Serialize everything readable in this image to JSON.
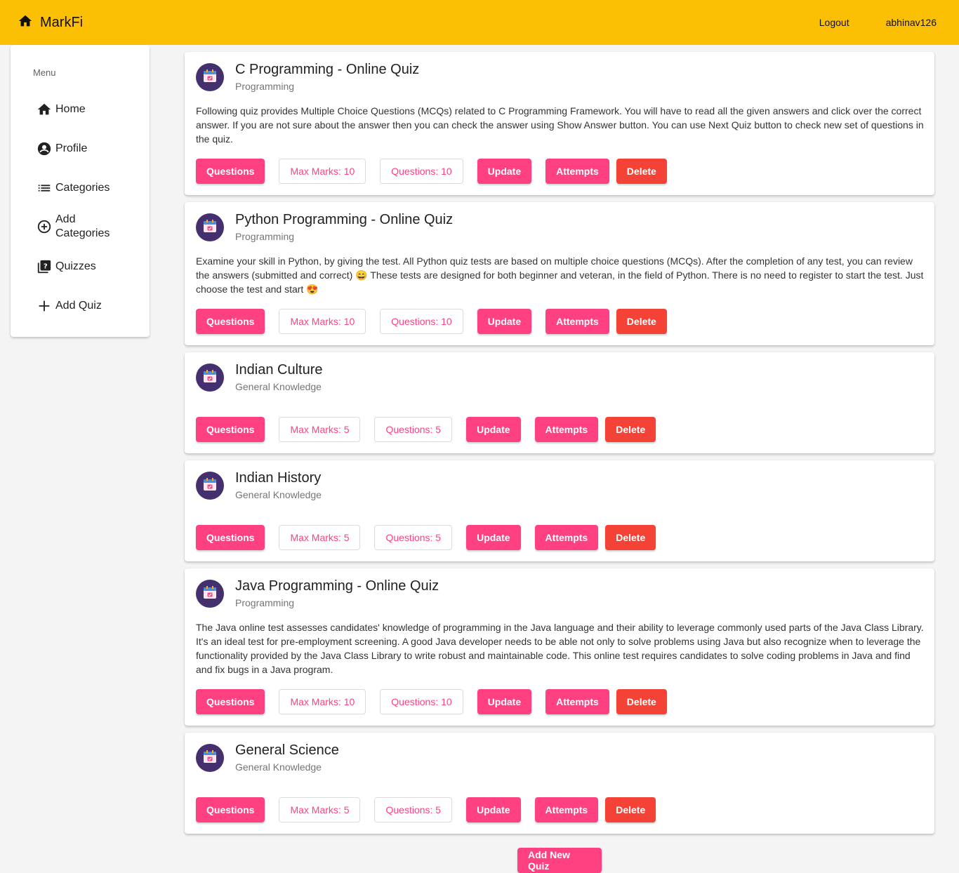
{
  "header": {
    "brand": "MarkFi",
    "logout_label": "Logout",
    "username": "abhinav126"
  },
  "sidebar": {
    "title": "Menu",
    "items": [
      {
        "label": "Home",
        "icon": "home-icon"
      },
      {
        "label": "Profile",
        "icon": "account-circle-icon"
      },
      {
        "label": "Categories",
        "icon": "list-icon"
      },
      {
        "label": "Add Categories",
        "icon": "add-circle-icon"
      },
      {
        "label": "Quizzes",
        "icon": "quiz-icon"
      },
      {
        "label": "Add Quiz",
        "icon": "plus-icon"
      }
    ]
  },
  "buttons": {
    "questions": "Questions",
    "update": "Update",
    "attempts": "Attempts",
    "delete": "Delete"
  },
  "quizzes": [
    {
      "title": "C Programming - Online Quiz",
      "category": "Programming",
      "description": "Following quiz provides Multiple Choice Questions (MCQs) related to C Programming Framework. You will have to read all the given answers and click over the correct answer. If you are not sure about the answer then you can check the answer using Show Answer button. You can use Next Quiz button to check new set of questions in the quiz.",
      "max_marks": "Max Marks: 10",
      "questions": "Questions: 10"
    },
    {
      "title": "Python Programming - Online Quiz",
      "category": "Programming",
      "description": "Examine your skill in Python, by giving the test. All Python quiz tests are based on multiple choice questions (MCQs). After the completion of any test, you can review the answers (submitted and correct) 😄 These tests are designed for both beginner and veteran, in the field of Python. There is no need to register to start the test. Just choose the test and start 😍",
      "max_marks": "Max Marks: 10",
      "questions": "Questions: 10"
    },
    {
      "title": "Indian Culture",
      "category": "General Knowledge",
      "description": "",
      "max_marks": "Max Marks: 5",
      "questions": "Questions: 5"
    },
    {
      "title": "Indian History",
      "category": "General Knowledge",
      "description": "",
      "max_marks": "Max Marks: 5",
      "questions": "Questions: 5"
    },
    {
      "title": "Java Programming - Online Quiz",
      "category": "Programming",
      "description": "The Java online test assesses candidates' knowledge of programming in the Java language and their ability to leverage commonly used parts of the Java Class Library. It's an ideal test for pre-employment screening. A good Java developer needs to be able not only to solve problems using Java but also recognize when to leverage the functionality provided by the Java Class Library to write robust and maintainable code. This online test requires candidates to solve coding problems in Java and find and fix bugs in a Java program.",
      "max_marks": "Max Marks: 10",
      "questions": "Questions: 10"
    },
    {
      "title": "General Science",
      "category": "General Knowledge",
      "description": "",
      "max_marks": "Max Marks: 5",
      "questions": "Questions: 5"
    }
  ],
  "footer": {
    "add_new_quiz": "Add New Quiz"
  },
  "colors": {
    "topbar": "#fbbf04",
    "accent": "#ff4081",
    "warn": "#f44336",
    "avatar": "#44306f"
  }
}
